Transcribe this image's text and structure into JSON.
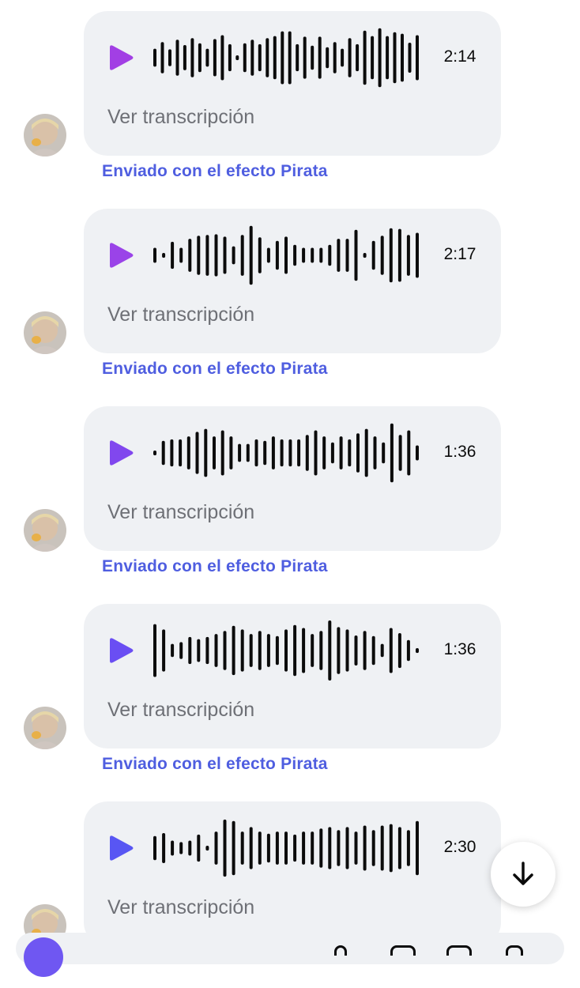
{
  "messages": [
    {
      "duration": "2:14",
      "transcription_label": "Ver transcripción",
      "effect_label": "Enviado con el efecto Pirata",
      "play_color": "#a23fe4",
      "waveform": [
        0.3,
        0.52,
        0.28,
        0.6,
        0.42,
        0.65,
        0.48,
        0.3,
        0.62,
        0.75,
        0.45,
        0.08,
        0.48,
        0.6,
        0.45,
        0.65,
        0.72,
        0.88,
        0.88,
        0.45,
        0.7,
        0.4,
        0.7,
        0.35,
        0.52,
        0.3,
        0.65,
        0.45,
        0.9,
        0.72,
        0.98,
        0.72,
        0.85,
        0.8,
        0.5,
        0.75
      ]
    },
    {
      "duration": "2:17",
      "transcription_label": "Ver transcripción",
      "effect_label": "Enviado con el efecto Pirata",
      "play_color": "#9a43e8",
      "waveform": [
        0.25,
        0.08,
        0.45,
        0.25,
        0.55,
        0.65,
        0.68,
        0.7,
        0.62,
        0.3,
        0.68,
        0.98,
        0.6,
        0.25,
        0.48,
        0.62,
        0.35,
        0.25,
        0.25,
        0.25,
        0.35,
        0.55,
        0.55,
        0.85,
        0.08,
        0.48,
        0.65,
        0.9,
        0.88,
        0.68,
        0.75
      ]
    },
    {
      "duration": "1:36",
      "transcription_label": "Ver transcripción",
      "effect_label": "Enviado con el efecto Pirata",
      "play_color": "#8147ee",
      "waveform": [
        0.08,
        0.4,
        0.45,
        0.45,
        0.55,
        0.7,
        0.8,
        0.55,
        0.75,
        0.55,
        0.3,
        0.3,
        0.45,
        0.4,
        0.55,
        0.45,
        0.45,
        0.45,
        0.6,
        0.75,
        0.55,
        0.35,
        0.55,
        0.45,
        0.65,
        0.8,
        0.55,
        0.35,
        0.98,
        0.6,
        0.75,
        0.25
      ]
    },
    {
      "duration": "1:36",
      "transcription_label": "Ver transcripción",
      "effect_label": "Enviado con el efecto Pirata",
      "play_color": "#6a4ef3",
      "waveform": [
        0.88,
        0.7,
        0.22,
        0.28,
        0.45,
        0.38,
        0.45,
        0.55,
        0.65,
        0.82,
        0.7,
        0.55,
        0.65,
        0.55,
        0.48,
        0.7,
        0.85,
        0.75,
        0.55,
        0.65,
        1.0,
        0.78,
        0.7,
        0.5,
        0.65,
        0.48,
        0.22,
        0.75,
        0.58,
        0.35,
        0.08
      ]
    },
    {
      "duration": "2:30",
      "transcription_label": "Ver transcripción",
      "effect_label": "",
      "play_color": "#5856f3",
      "waveform": [
        0.4,
        0.5,
        0.25,
        0.2,
        0.25,
        0.45,
        0.08,
        0.55,
        0.95,
        0.9,
        0.55,
        0.7,
        0.55,
        0.48,
        0.55,
        0.55,
        0.45,
        0.55,
        0.55,
        0.65,
        0.7,
        0.6,
        0.7,
        0.55,
        0.75,
        0.6,
        0.75,
        0.8,
        0.7,
        0.6,
        0.9
      ]
    }
  ]
}
